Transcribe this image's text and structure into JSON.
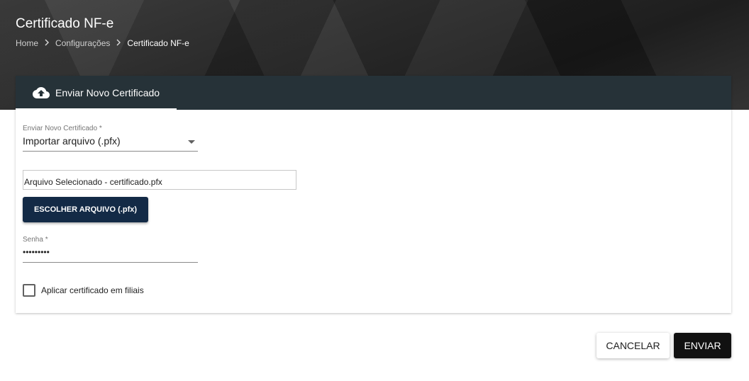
{
  "header": {
    "title": "Certificado NF-e",
    "breadcrumb": [
      {
        "label": "Home"
      },
      {
        "label": "Configurações"
      },
      {
        "label": "Certificado NF-e"
      }
    ]
  },
  "tab": {
    "label": "Enviar Novo Certificado",
    "icon": "cloud-upload-icon"
  },
  "form": {
    "type_select": {
      "label": "Enviar Novo Certificado *",
      "value": "Importar arquivo (.pfx)"
    },
    "file": {
      "value": "Arquivo Selecionado - certificado.pfx"
    },
    "choose_button_label": "ESCOLHER ARQUIVO (.pfx)",
    "password": {
      "label": "Senha *",
      "masked_value": "•••••••••"
    },
    "apply_branches": {
      "label": "Aplicar certificado em filiais",
      "checked": false
    }
  },
  "actions": {
    "cancel_label": "CANCELAR",
    "send_label": "ENVIAR"
  },
  "colors": {
    "tabbar": "#263238",
    "primary_button": "#132a46",
    "send_button": "#111111"
  }
}
